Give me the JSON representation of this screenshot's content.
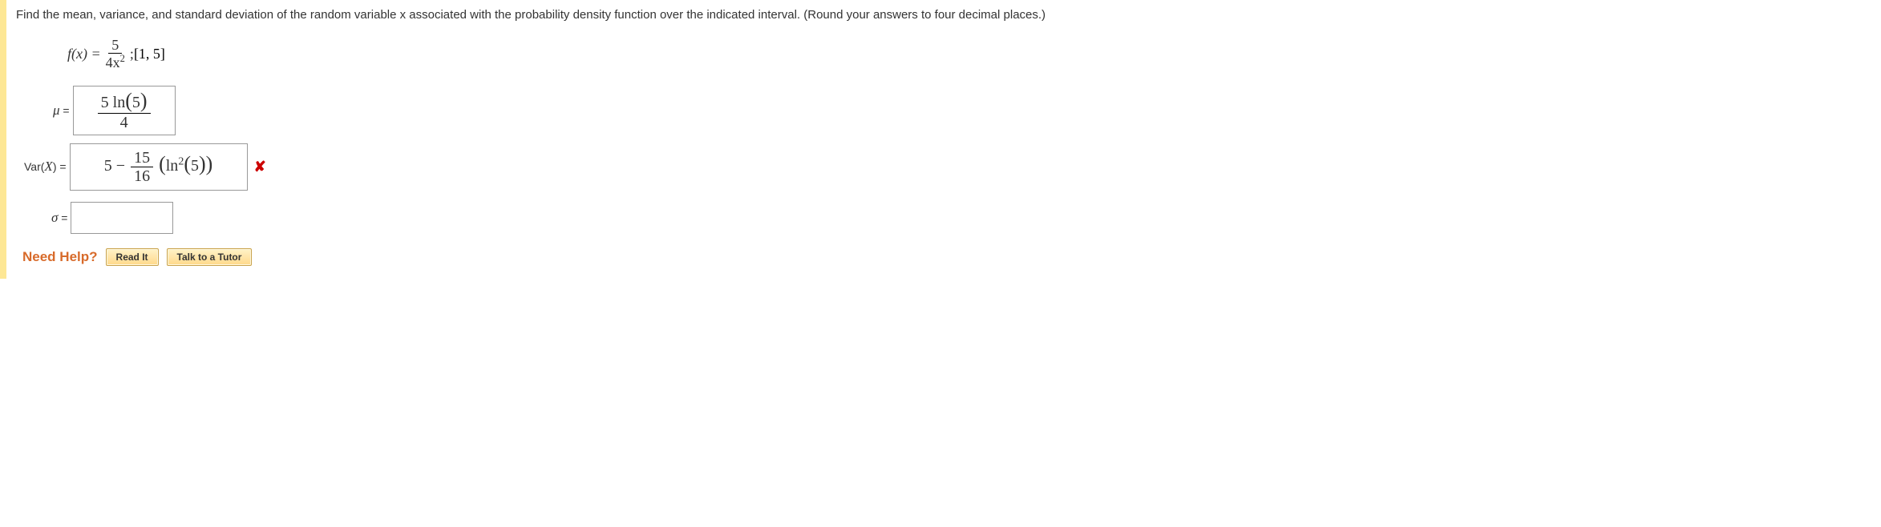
{
  "question": {
    "prompt_full": "Find the mean, variance, and standard deviation of the random variable x associated with the probability density function over the indicated interval. (Round your answers to four decimal places.)",
    "formula": {
      "lhs": "f(x) = ",
      "frac_num": "5",
      "frac_den_base": "4x",
      "frac_den_exp": "2",
      "after": "; ",
      "interval": "[1, 5]"
    }
  },
  "answers": {
    "mu": {
      "label_sym": "μ",
      "eq": " = ",
      "value_num_pre": "5 ln",
      "value_num_arg": "5",
      "value_den": "4"
    },
    "var": {
      "label": "Var(X)",
      "eq": " = ",
      "leading": "5 − ",
      "frac_num": "15",
      "frac_den": "16",
      "tail_pre": "ln",
      "tail_exp": "2",
      "tail_arg": "5",
      "marked_wrong": true
    },
    "sigma": {
      "label_sym": "σ",
      "eq": " = ",
      "value": ""
    }
  },
  "help": {
    "label": "Need Help?",
    "read": "Read It",
    "tutor": "Talk to a Tutor"
  },
  "icons": {
    "wrong": "✘"
  }
}
